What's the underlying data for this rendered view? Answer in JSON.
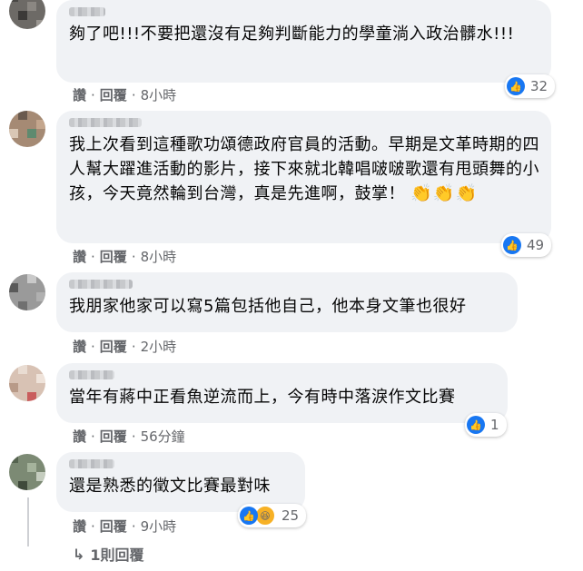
{
  "comments": [
    {
      "text": "夠了吧!!!不要把還沒有足夠判斷能力的學童淌入政治髒水!!!",
      "emoji": "",
      "reaction_count": "32",
      "actions": {
        "like": "讚",
        "reply": "回覆",
        "time": "8小時"
      }
    },
    {
      "text": "我上次看到這種歌功頌德政府官員的活動。早期是文革時期的四人幫大躍進活動的影片，接下來就北韓唱啵啵歌還有甩頭舞的小孩，今天竟然輪到台灣，真是先進啊，鼓掌！",
      "emoji": "👏👏👏",
      "reaction_count": "49",
      "actions": {
        "like": "讚",
        "reply": "回覆",
        "time": "8小時"
      }
    },
    {
      "text": "我朋家他家可以寫5篇包括他自己，他本身文筆也很好",
      "emoji": "",
      "reaction_count": "",
      "actions": {
        "like": "讚",
        "reply": "回覆",
        "time": "2小時"
      }
    },
    {
      "text": "當年有蔣中正看魚逆流而上，今有時中落淚作文比賽",
      "emoji": "",
      "reaction_count": "1",
      "actions": {
        "like": "讚",
        "reply": "回覆",
        "time": "56分鐘"
      }
    },
    {
      "text": "還是熟悉的徵文比賽最對味",
      "emoji": "",
      "reaction_count": "25",
      "actions": {
        "like": "讚",
        "reply": "回覆",
        "time": "9小時"
      }
    }
  ],
  "replies_link": "1則回覆",
  "icons": {
    "like": "thumbs-up-icon",
    "haha": "haha-icon",
    "reply_arrow": "reply-arrow-icon"
  },
  "colors": {
    "like_blue": "#1877f2",
    "bubble": "#f0f2f5",
    "meta": "#65676b",
    "haha": "#f7b125"
  }
}
